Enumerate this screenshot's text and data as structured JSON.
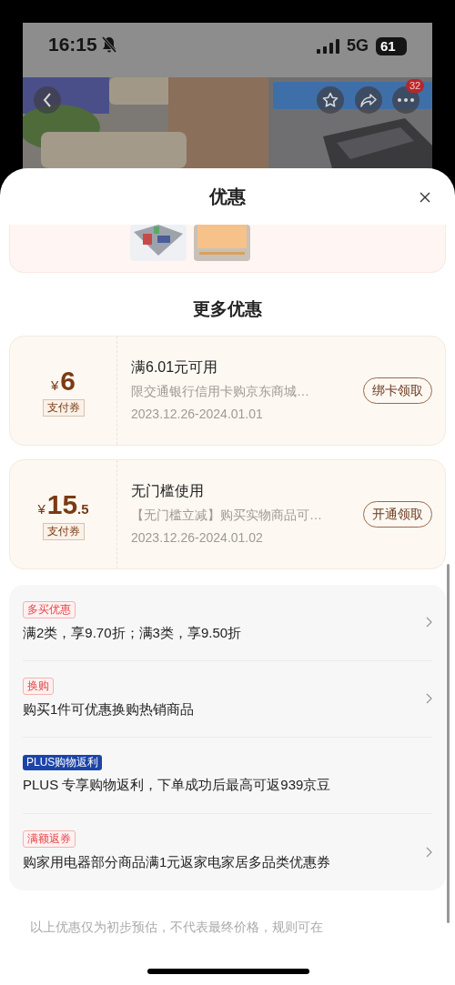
{
  "status_bar": {
    "time": "16:15",
    "network": "5G",
    "battery": "61"
  },
  "product_page": {
    "more_badge": "32"
  },
  "sheet": {
    "title": "优惠",
    "section_title": "更多优惠"
  },
  "coupons": [
    {
      "currency": "¥",
      "amount": "6",
      "tag": "支付券",
      "title": "满6.01元可用",
      "description": "限交通银行信用卡购京东商城…",
      "validity": "2023.12.26-2024.01.01",
      "button": "绑卡领取"
    },
    {
      "currency": "¥",
      "amount": "15",
      "fraction": ".5",
      "tag": "支付券",
      "title": "无门槛使用",
      "description": "【无门槛立减】购买实物商品可…",
      "validity": "2023.12.26-2024.01.02",
      "button": "开通领取"
    }
  ],
  "promotions": [
    {
      "tag": "多买优惠",
      "kind": "outline",
      "text": "满2类，享9.70折；满3类，享9.50折",
      "has_arrow": true
    },
    {
      "tag": "换购",
      "kind": "outline",
      "text": "购买1件可优惠换购热销商品",
      "has_arrow": true
    },
    {
      "tag": "PLUS购物返利",
      "kind": "plus",
      "text": "PLUS 专享购物返利，下单成功后最高可返939京豆",
      "has_arrow": false
    },
    {
      "tag": "满额返券",
      "kind": "outline",
      "text": "购家用电器部分商品满1元返家电家居多品类优惠券",
      "has_arrow": true
    }
  ],
  "disclaimer": "以上优惠仅为初步预估，不代表最终价格，规则可在"
}
